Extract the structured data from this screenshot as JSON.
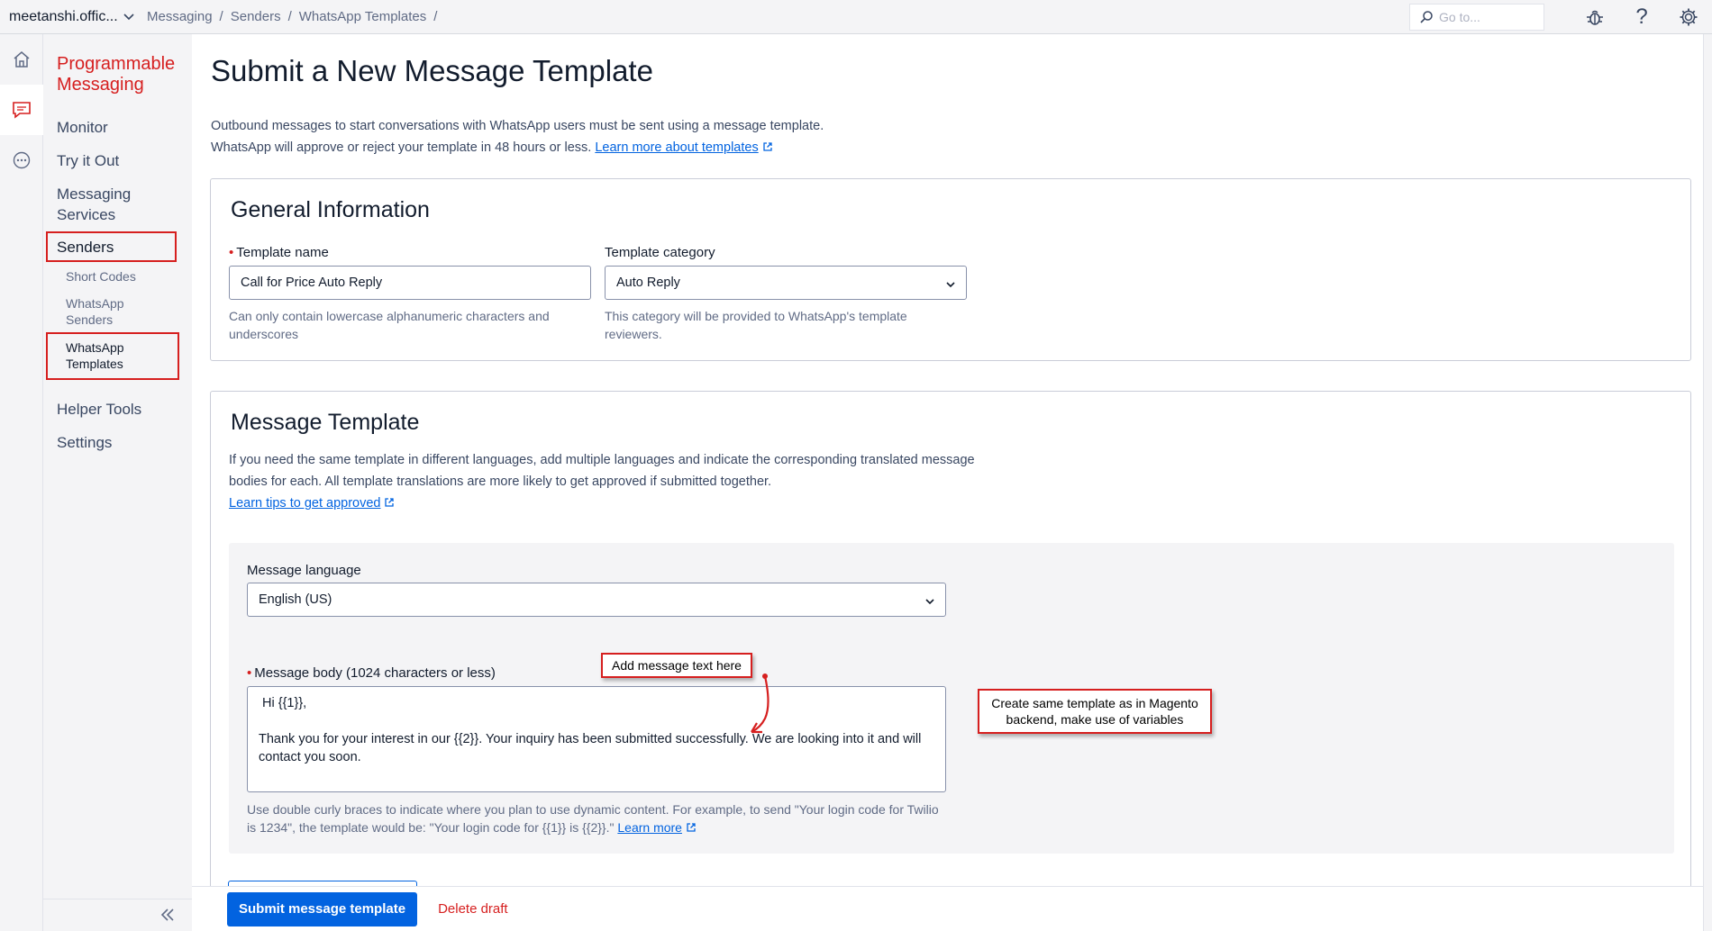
{
  "topbar": {
    "account": "meetanshi.offic...",
    "breadcrumbs": [
      "Messaging",
      "Senders",
      "WhatsApp Templates"
    ],
    "search_placeholder": "Go to..."
  },
  "nav": {
    "title": "Programmable Messaging",
    "items": {
      "monitor": "Monitor",
      "try_it_out": "Try it Out",
      "messaging_services": "Messaging Services",
      "senders": "Senders",
      "helper_tools": "Helper Tools",
      "settings": "Settings"
    },
    "sub_items": {
      "short_codes": "Short Codes",
      "whatsapp_senders": "WhatsApp Senders",
      "whatsapp_templates": "WhatsApp Templates"
    }
  },
  "page": {
    "title": "Submit a New Message Template",
    "intro_line1": "Outbound messages to start conversations with WhatsApp users must be sent using a message template.",
    "intro_line2": "WhatsApp will approve or reject your template in 48 hours or less.",
    "intro_link": "Learn more about templates"
  },
  "general": {
    "title": "General Information",
    "name_label": "Template name",
    "name_value": "Call for Price Auto Reply",
    "name_help": "Can only contain lowercase alphanumeric characters and underscores",
    "category_label": "Template category",
    "category_value": "Auto Reply",
    "category_help": "This category will be provided to WhatsApp's template reviewers."
  },
  "message_template": {
    "title": "Message Template",
    "description": "If you need the same template in different languages, add multiple languages and indicate the corresponding translated message bodies for each. All template translations are more likely to get approved if submitted together.",
    "tips_link": "Learn tips to get approved",
    "language_label": "Message language",
    "language_value": "English (US)",
    "body_label": "Message body (1024 characters or less)",
    "body_line1": "Hi {{1}},",
    "body_line2": "Thank you for your interest in our {{2}}. Your inquiry has been submitted successfully. We are looking into it and will contact you soon.",
    "body_help": "Use double curly braces to indicate where you plan to use dynamic content. For example, to send \"Your login code for Twilio is 1234\", the template would be: \"Your login code for {{1}} is {{2}}.\"",
    "body_help_link": "Learn more"
  },
  "annotations": {
    "add_text": "Add message text here",
    "same_template": "Create same template as in Magento backend, make use of variables"
  },
  "footer": {
    "submit": "Submit message template",
    "delete": "Delete draft"
  },
  "colors": {
    "brand_red": "#d61f1f",
    "primary_blue": "#0263e0"
  }
}
